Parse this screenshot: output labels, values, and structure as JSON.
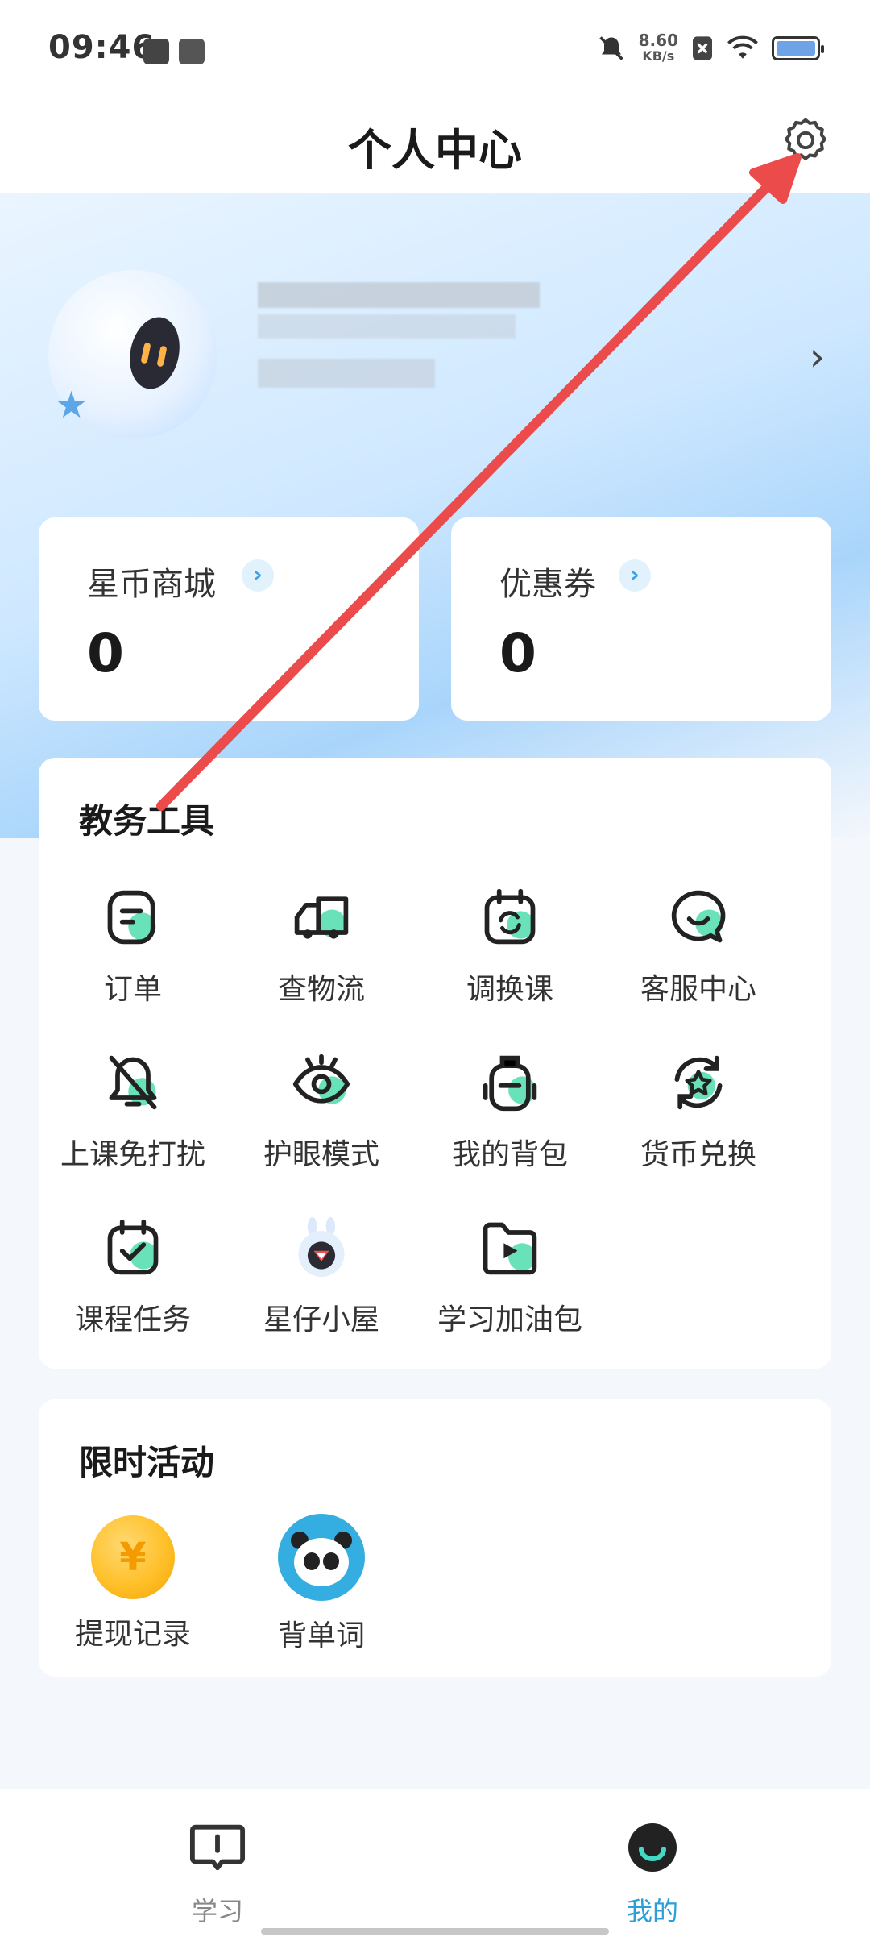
{
  "status_bar": {
    "time": "09:46",
    "speed_value": "8.60",
    "speed_unit": "KB/s"
  },
  "header": {
    "title": "个人中心",
    "settings_icon": "gear-icon"
  },
  "stats": [
    {
      "label": "星币商城",
      "value": "0"
    },
    {
      "label": "优惠券",
      "value": "0"
    }
  ],
  "tools": {
    "title": "教务工具",
    "items": [
      {
        "label": "订单",
        "icon": "order-icon"
      },
      {
        "label": "查物流",
        "icon": "truck-icon"
      },
      {
        "label": "调换课",
        "icon": "calendar-swap-icon"
      },
      {
        "label": "客服中心",
        "icon": "chat-icon"
      },
      {
        "label": "上课免打扰",
        "icon": "bell-off-icon"
      },
      {
        "label": "护眼模式",
        "icon": "eye-icon"
      },
      {
        "label": "我的背包",
        "icon": "backpack-icon"
      },
      {
        "label": "货币兑换",
        "icon": "exchange-icon"
      },
      {
        "label": "课程任务",
        "icon": "calendar-check-icon"
      },
      {
        "label": "星仔小屋",
        "icon": "mascot-icon"
      },
      {
        "label": "学习加油包",
        "icon": "video-folder-icon"
      }
    ]
  },
  "activities": {
    "title": "限时活动",
    "items": [
      {
        "label": "提现记录",
        "icon": "coin-icon",
        "glyph": "¥"
      },
      {
        "label": "背单词",
        "icon": "panda-icon"
      }
    ]
  },
  "nav": {
    "items": [
      {
        "label": "学习",
        "active": false
      },
      {
        "label": "我的",
        "active": true
      }
    ],
    "active_color": "#2a9fd8",
    "inactive_color": "#888888"
  },
  "colors": {
    "accent_green": "#43d9a8",
    "annotation_arrow": "#ec4b4b"
  }
}
